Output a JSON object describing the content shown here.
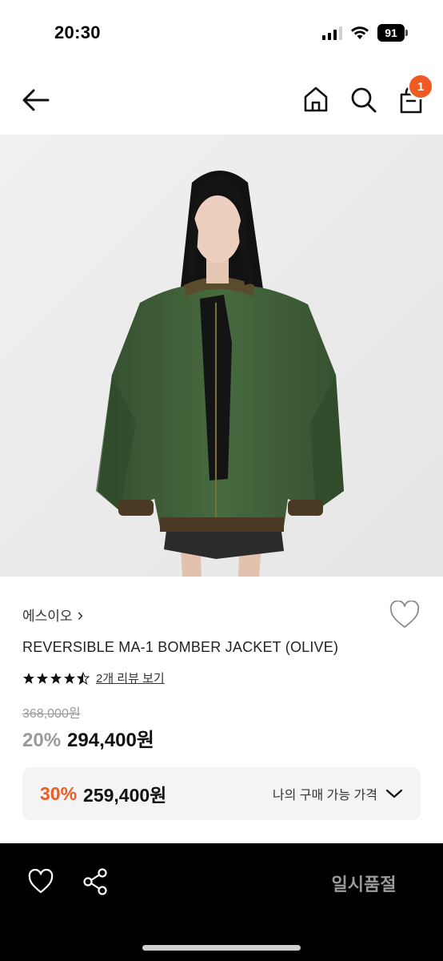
{
  "status_bar": {
    "time": "20:30",
    "battery": "91",
    "icons": [
      "cellular-signal-icon",
      "wifi-icon",
      "battery-icon"
    ]
  },
  "header": {
    "icons": [
      "back-arrow-icon",
      "home-icon",
      "search-icon",
      "shopping-bag-icon"
    ],
    "cart_count": "1"
  },
  "product": {
    "image_alt": "REVERSIBLE MA-1 BOMBER JACKET (OLIVE)",
    "brand": "에스이오",
    "brand_chevron": "›",
    "name": "REVERSIBLE MA-1 BOMBER JACKET (OLIVE)",
    "rating": 4.5,
    "review_link": "2개 리뷰 보기",
    "original_price": "368,000원",
    "discount_rate": "20%",
    "sale_price": "294,400원"
  },
  "benefit": {
    "rate": "30%",
    "price": "259,400원",
    "label": "나의 구매 가능 가격"
  },
  "bottom_bar": {
    "status": "일시품절",
    "icons": [
      "heart-icon",
      "share-icon"
    ]
  },
  "colors": {
    "accent": "#f05a23",
    "bottom_bar": "#000000",
    "muted_text": "#9a9a9a",
    "jacket": "#3f5e38"
  }
}
